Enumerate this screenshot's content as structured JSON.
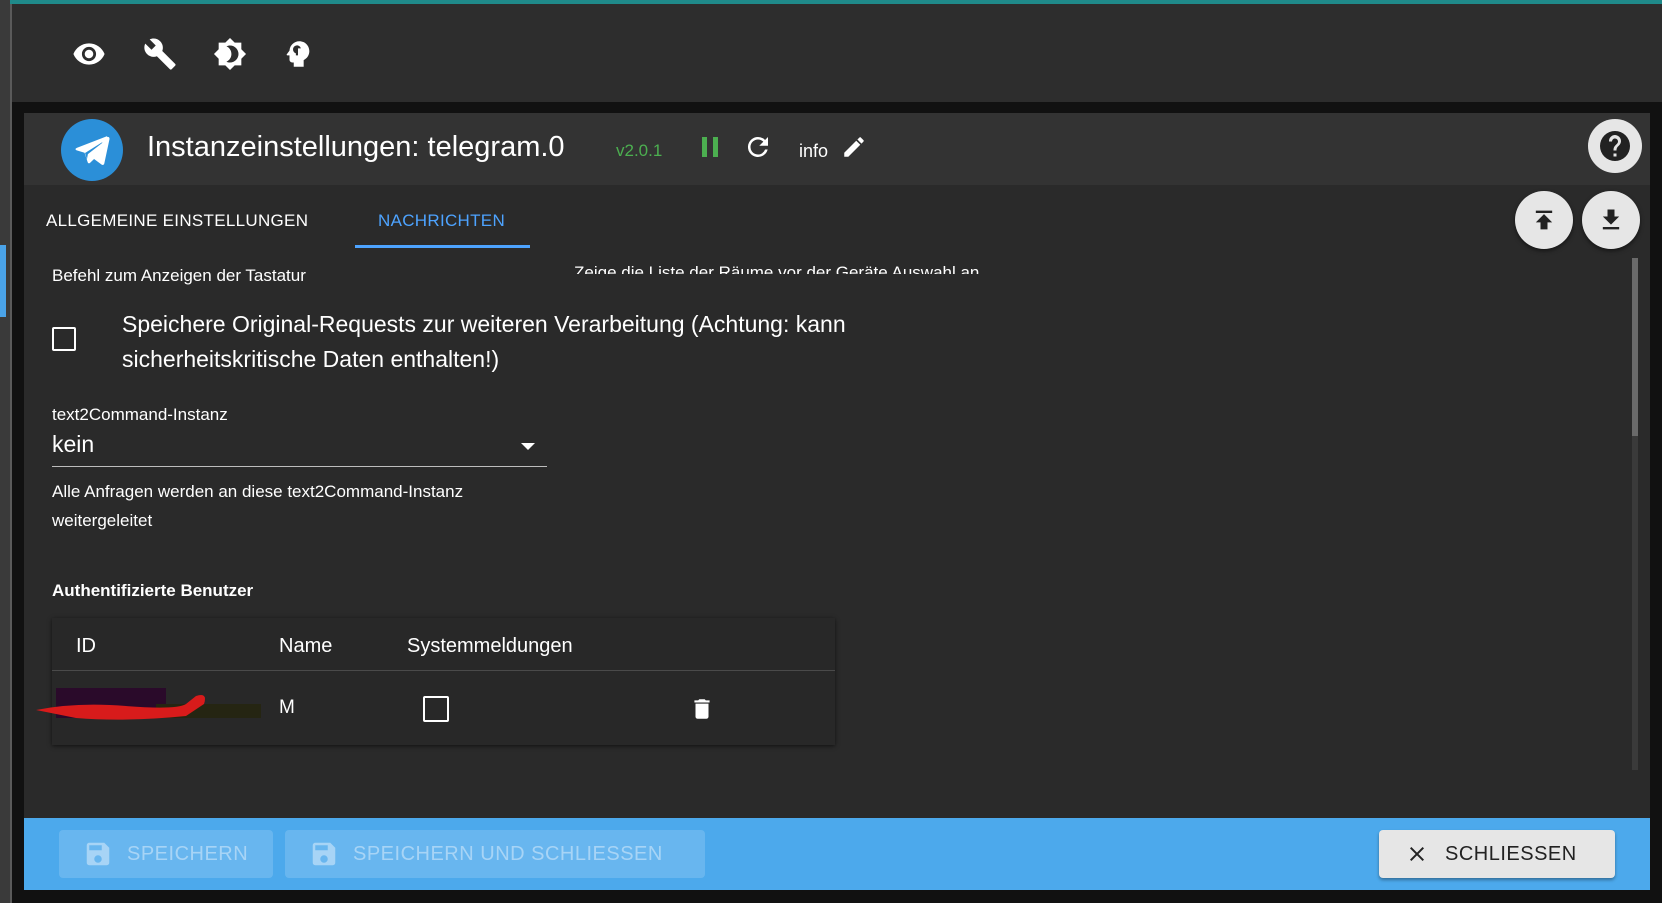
{
  "toolbar": {
    "icons": [
      "eye-icon",
      "wrench-icon",
      "brightness-icon",
      "expert-mode-icon"
    ]
  },
  "dialog": {
    "title": "Instanzeinstellungen: telegram.0",
    "version": "v2.0.1",
    "info_label": "info",
    "tabs": [
      {
        "label": "ALLGEMEINE EINSTELLUNGEN",
        "active": false
      },
      {
        "label": "NACHRICHTEN",
        "active": true
      }
    ]
  },
  "content": {
    "keyboard_command_label": "Befehl zum Anzeigen der Tastatur",
    "rooms_list_label": "Zeige die Liste der Räume vor der Geräte Auswahl an",
    "save_raw_requests": {
      "label": "Speichere Original-Requests zur weiteren Verarbeitung (Achtung: kann sicherheitskritische Daten enthalten!)",
      "checked": false
    },
    "text2command": {
      "label": "text2Command-Instanz",
      "value": "kein",
      "help": "Alle Anfragen werden an diese text2Command-Instanz weitergeleitet"
    },
    "users_section_title": "Authentifizierte Benutzer",
    "users_table": {
      "headers": {
        "id": "ID",
        "name": "Name",
        "system": "Systemmeldungen"
      },
      "rows": [
        {
          "id": "",
          "name": "M",
          "system_messages": false
        }
      ]
    }
  },
  "footer": {
    "save_label": "SPEICHERN",
    "save_close_label": "SPEICHERN UND SCHLIESSEN",
    "close_label": "SCHLIESSEN"
  },
  "colors": {
    "accent_blue": "#4ca9ec",
    "tab_active": "#4da3ff",
    "version_green": "#4caf50",
    "background": "#2a2a2a"
  }
}
